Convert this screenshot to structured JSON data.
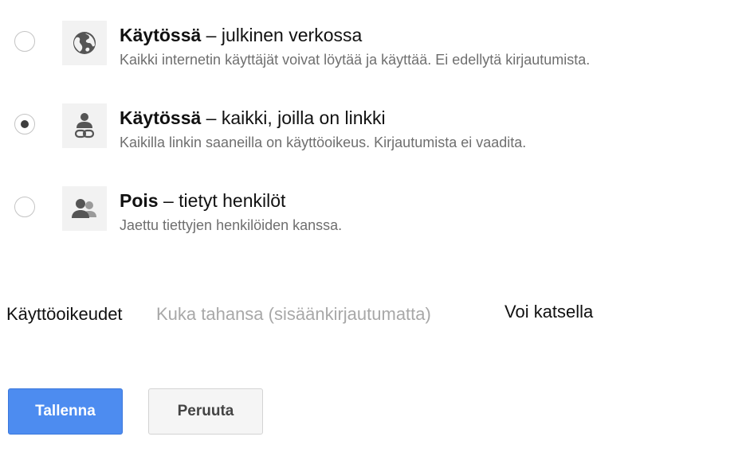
{
  "options": [
    {
      "title_bold": "Käytössä",
      "title_rest": " – julkinen verkossa",
      "description": "Kaikki internetin käyttäjät voivat löytää ja käyttää. Ei edellytä kirjautumista.",
      "icon": "globe-icon",
      "selected": false
    },
    {
      "title_bold": "Käytössä",
      "title_rest": " – kaikki, joilla on linkki",
      "description": "Kaikilla linkin saaneilla on käyttöoikeus. Kirjautumista ei vaadita.",
      "icon": "person-link-icon",
      "selected": true
    },
    {
      "title_bold": "Pois",
      "title_rest": " – tietyt henkilöt",
      "description": "Jaettu tiettyjen henkilöiden kanssa.",
      "icon": "people-icon",
      "selected": false
    }
  ],
  "access": {
    "label": "Käyttöoikeudet",
    "who": "Kuka tahansa (sisäänkirjautumatta)",
    "level": "Voi katsella"
  },
  "buttons": {
    "save": "Tallenna",
    "cancel": "Peruuta"
  },
  "colors": {
    "primary": "#4d8cf0",
    "icon": "#555555"
  }
}
